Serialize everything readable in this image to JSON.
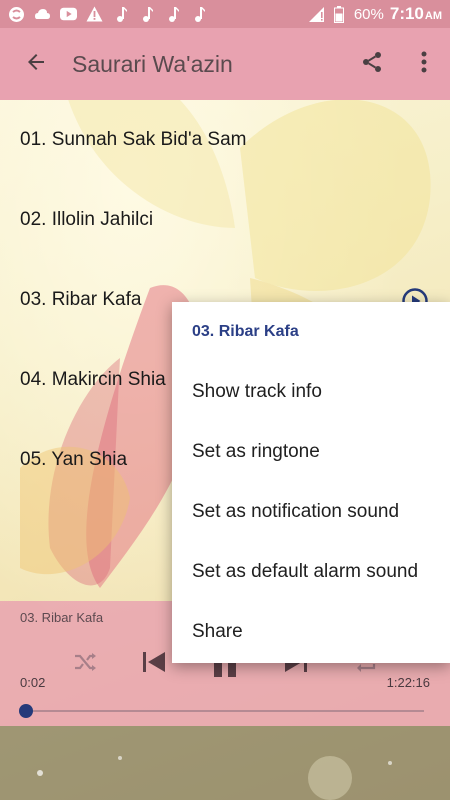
{
  "status_bar": {
    "battery": "60%",
    "time": "7:10",
    "ampm": "AM"
  },
  "app_bar": {
    "title": "Saurari Wa'azin"
  },
  "tracks": [
    {
      "label": "01. Sunnah Sak Bid'a Sam"
    },
    {
      "label": "02. Illolin Jahilci"
    },
    {
      "label": "03. Ribar Kafa"
    },
    {
      "label": "04. Makircin Shia"
    },
    {
      "label": "05. Yan Shia"
    }
  ],
  "player": {
    "now_playing": "03. Ribar Kafa",
    "current_time": "0:02",
    "total_time": "1:22:16",
    "progress": 0.0
  },
  "context_menu": {
    "header": "03. Ribar Kafa",
    "items": [
      {
        "label": "Show track info"
      },
      {
        "label": "Set as ringtone"
      },
      {
        "label": "Set as notification sound"
      },
      {
        "label": "Set as default alarm sound"
      },
      {
        "label": "Share"
      }
    ]
  },
  "colors": {
    "status_bar": "#d98f9c",
    "app_bar": "#e8a2b0",
    "accent": "#2b3f86"
  }
}
